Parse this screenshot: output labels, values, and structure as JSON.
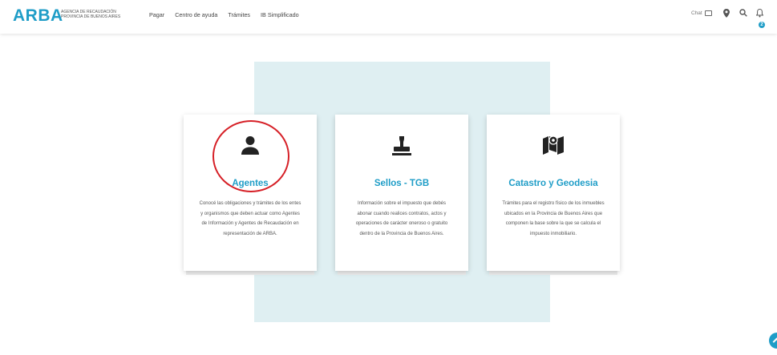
{
  "header": {
    "logo": "ARBA",
    "logo_subtitle_1": "AGENCIA DE RECAUDACIÓN",
    "logo_subtitle_2": "PROVINCIA DE BUENOS AIRES",
    "nav": [
      "Pagar",
      "Centro de ayuda",
      "Trámites",
      "IB Simplificado"
    ],
    "chat_label": "Chat",
    "notifications_count": "2",
    "icons": [
      "chat-icon",
      "location-icon",
      "search-icon",
      "bell-icon",
      "more-icon"
    ]
  },
  "cards": [
    {
      "icon": "user-icon",
      "title": "Agentes",
      "description": "Conocé las obligaciones y trámites de los entes y organismos que deben actuar como Agentes de Información y Agentes de Recaudación en representación de ARBA."
    },
    {
      "icon": "stamp-icon",
      "title": "Sellos - TGB",
      "description": "Información sobre el impuesto que debés abonar cuando realices contratos, actos y operaciones de carácter oneroso o gratuito dentro de la Provincia de Buenos Aires."
    },
    {
      "icon": "map-icon",
      "title": "Catastro y Geodesia",
      "description": "Trámites para el registro físico de los inmuebles ubicados en la Provincia de Buenos Aires que componen la base sobre la que se calcula el impuesto inmobiliario."
    }
  ],
  "colors": {
    "accent": "#1f9dc7",
    "panel": "#dfeff2",
    "highlight": "#d62027"
  }
}
